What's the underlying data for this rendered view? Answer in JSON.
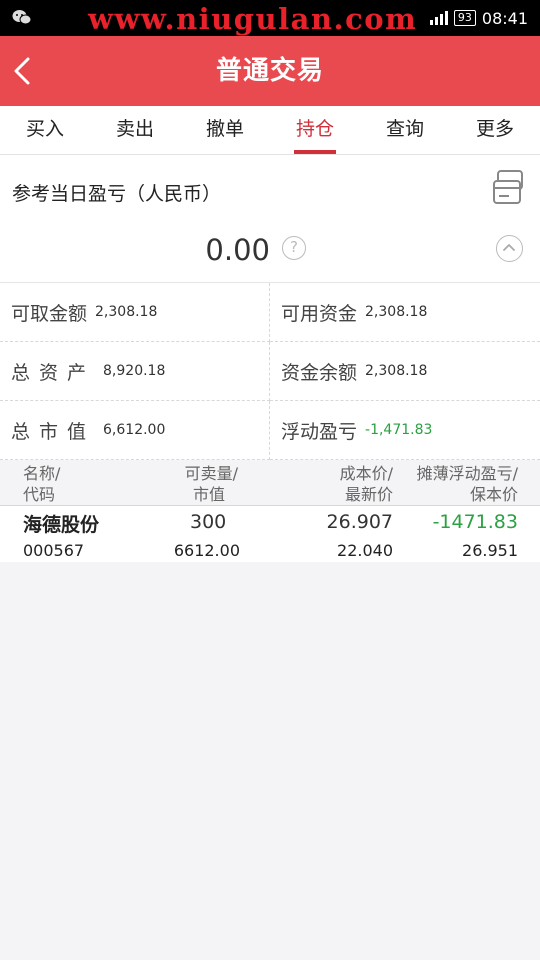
{
  "status_bar": {
    "watermark": "www.niugulan.com",
    "battery": "93",
    "time": "08:41",
    "app_icon": "wechat-icon"
  },
  "header": {
    "title": "普通交易",
    "back_icon": "chevron-left-icon",
    "background": "#e84a4f"
  },
  "tabs": [
    {
      "label": "买入",
      "active": false
    },
    {
      "label": "卖出",
      "active": false
    },
    {
      "label": "撤单",
      "active": false
    },
    {
      "label": "持仓",
      "active": true
    },
    {
      "label": "查询",
      "active": false
    },
    {
      "label": "更多",
      "active": false
    }
  ],
  "profit": {
    "label": "参考当日盈亏（人民币）",
    "value": "0.00",
    "help": "?"
  },
  "summary": {
    "withdrawable_label": "可取金额",
    "withdrawable_value": "2,308.18",
    "available_label": "可用资金",
    "available_value": "2,308.18",
    "total_assets_label": "总资产",
    "total_assets_value": "8,920.18",
    "balance_label": "资金余额",
    "balance_value": "2,308.18",
    "market_value_label": "总市值",
    "market_value_value": "6,612.00",
    "floating_pl_label": "浮动盈亏",
    "floating_pl_value": "-1,471.83"
  },
  "holdings": {
    "headers": {
      "name": "名称/",
      "code": "代码",
      "sellable": "可卖量/",
      "market_value": "市值",
      "cost": "成本价/",
      "latest": "最新价",
      "pl": "摊薄浮动盈亏/",
      "breakeven": "保本价"
    },
    "rows": [
      {
        "name": "海德股份",
        "code": "000567",
        "sellable": "300",
        "market_value": "6612.00",
        "cost": "26.907",
        "latest": "22.040",
        "pl": "-1471.83",
        "breakeven": "26.951"
      }
    ]
  },
  "colors": {
    "accent": "#d0303a",
    "loss_green": "#2aa142"
  }
}
